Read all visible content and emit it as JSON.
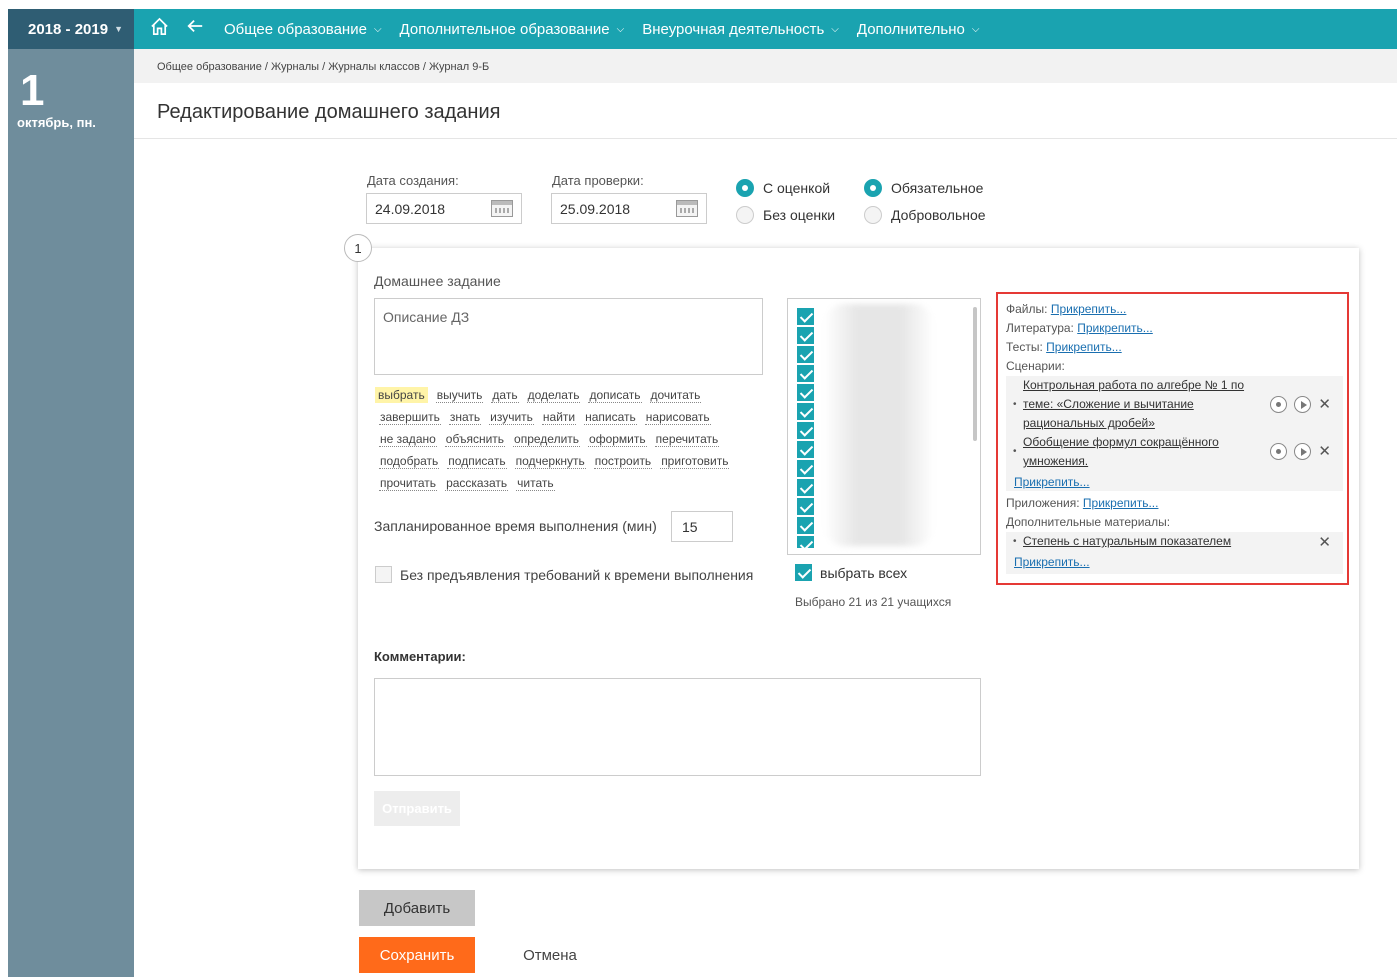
{
  "header": {
    "year": "2018 - 2019",
    "nav": [
      {
        "label": "Общее образование"
      },
      {
        "label": "Дополнительное образование"
      },
      {
        "label": "Внеурочная деятельность"
      },
      {
        "label": "Дополнительно"
      }
    ]
  },
  "sidebar": {
    "day": "1",
    "month": "октябрь, пн."
  },
  "breadcrumb": "Общее образование / Журналы / Журналы классов / Журнал 9-Б",
  "page_title": "Редактирование домашнего задания",
  "form": {
    "created_label": "Дата создания:",
    "created_value": "24.09.2018",
    "check_label": "Дата проверки:",
    "check_value": "25.09.2018",
    "grade_options": [
      {
        "label": "С оценкой",
        "selected": true
      },
      {
        "label": "Без оценки",
        "selected": false
      }
    ],
    "required_options": [
      {
        "label": "Обязательное",
        "selected": true
      },
      {
        "label": "Добровольное",
        "selected": false
      }
    ]
  },
  "task": {
    "number": "1",
    "section_label": "Домашнее задание",
    "description_placeholder": "Описание ДЗ",
    "verbs": [
      "выбрать",
      "выучить",
      "дать",
      "доделать",
      "дописать",
      "дочитать",
      "завершить",
      "знать",
      "изучить",
      "найти",
      "написать",
      "нарисовать",
      "не задано",
      "объяснить",
      "определить",
      "оформить",
      "перечитать",
      "подобрать",
      "подписать",
      "подчеркнуть",
      "построить",
      "приготовить",
      "прочитать",
      "рассказать",
      "читать"
    ],
    "highlighted_verb": "выбрать",
    "time_label": "Запланированное время выполнения (мин)",
    "time_value": "15",
    "no_time_label": "Без предъявления требований к времени выполнения",
    "select_all_label": "выбрать всех",
    "selected_count": "Выбрано 21 из 21 учащихся",
    "comment_label": "Комментарии:",
    "send_button": "Отправить"
  },
  "attachments": {
    "files_label": "Файлы:",
    "literature_label": "Литература:",
    "tests_label": "Тесты:",
    "scenarios_label": "Сценарии:",
    "attach_link": "Прикрепить...",
    "scenarios": [
      "Контрольная работа по алгебре № 1 по теме: «Сложение и вычитание рациональных дробей»",
      "Обобщение формул сокращённого умножения."
    ],
    "apps_label": "Приложения:",
    "extra_label": "Дополнительные материалы:",
    "extra_items": [
      "Степень с натуральным показателем"
    ]
  },
  "buttons": {
    "add": "Добавить",
    "save": "Сохранить",
    "cancel": "Отмена"
  },
  "colors": {
    "accent": "#1aa3b0",
    "sidebar": "#6f8d9c",
    "save": "#ff6a1a",
    "highlight": "#e53935"
  }
}
